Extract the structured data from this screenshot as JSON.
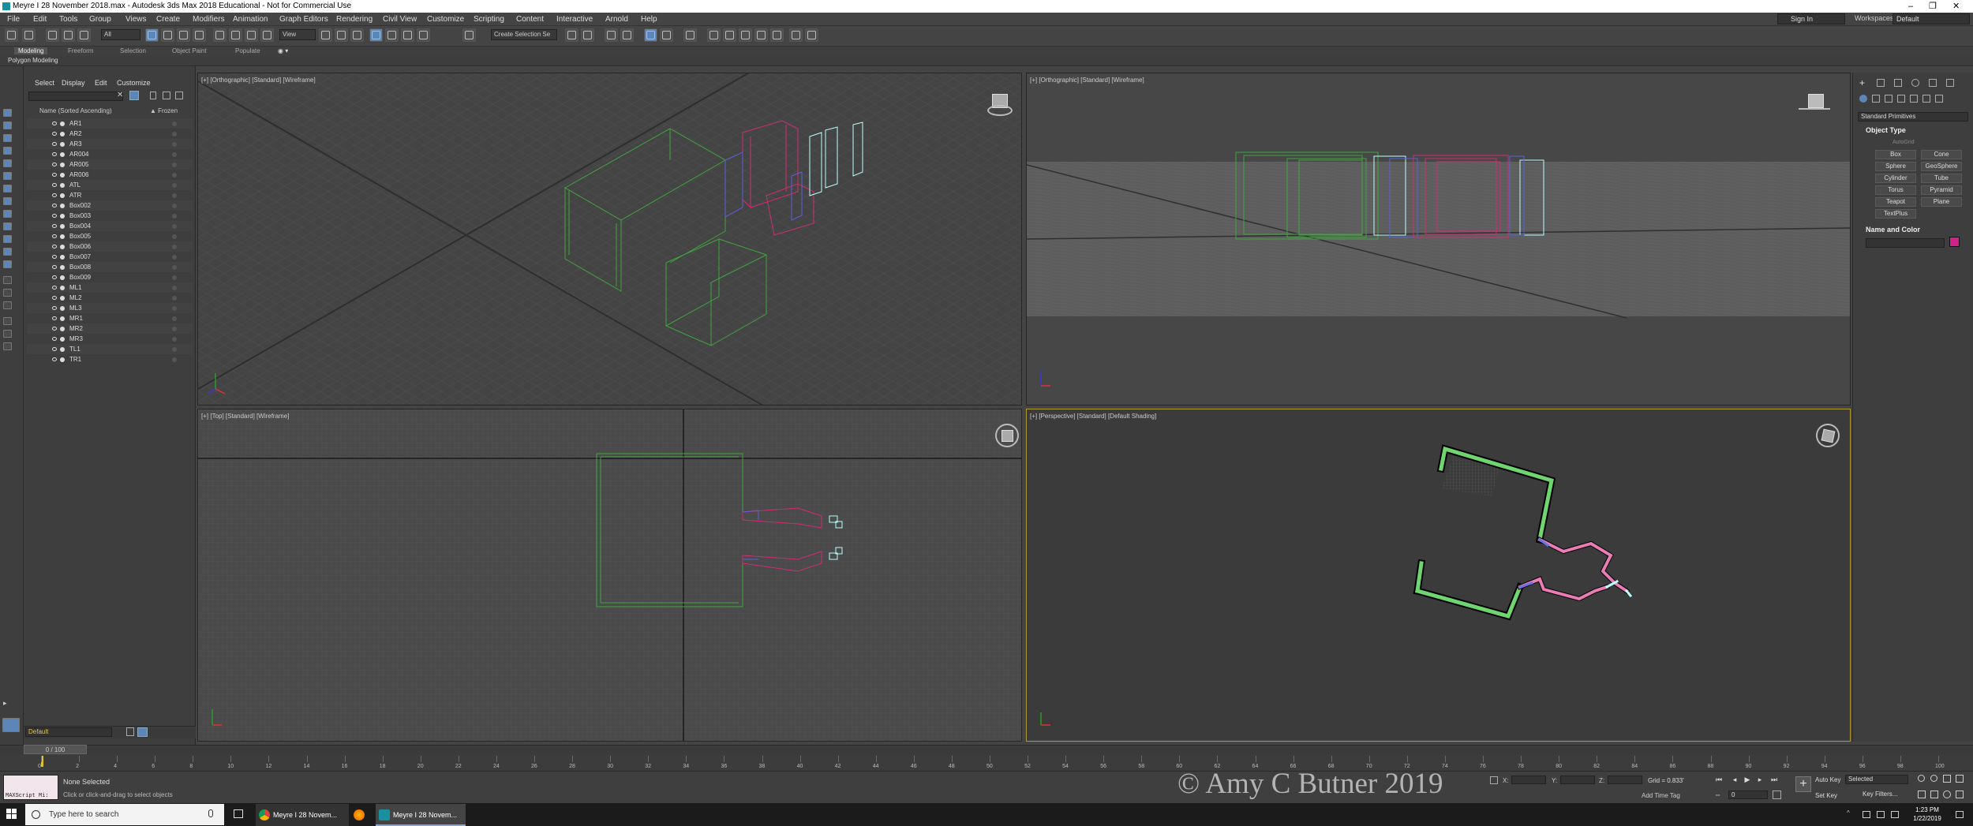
{
  "window": {
    "title": "Meyre I 28 November 2018.max - Autodesk 3ds Max 2018 Educational - Not for Commercial Use",
    "controls": [
      "–",
      "❐",
      "✕"
    ]
  },
  "menus": [
    "File",
    "Edit",
    "Tools",
    "Group",
    "Views",
    "Create",
    "Modifiers",
    "Animation",
    "Graph Editors",
    "Rendering",
    "Civil View",
    "Customize",
    "Scripting",
    "Content",
    "Interactive",
    "Arnold",
    "Help"
  ],
  "account": {
    "signin": "Sign In",
    "workspace_label": "Workspaces:",
    "workspace_value": "Default"
  },
  "toolbar": {
    "filter_value": "All",
    "view_value": "View",
    "selection_set": "Create Selection Se"
  },
  "ribbon": {
    "tabs": [
      "Modeling",
      "Freeform",
      "Selection",
      "Object Paint",
      "Populate"
    ],
    "active": "Modeling",
    "subtitle": "Polygon Modeling"
  },
  "scene_explorer": {
    "tabs": [
      "Select",
      "Display",
      "Edit",
      "Customize"
    ],
    "column_name": "Name (Sorted Ascending)",
    "column_frozen": "▲ Frozen",
    "items": [
      "AR1",
      "AR2",
      "AR3",
      "AR004",
      "AR005",
      "AR006",
      "ATL",
      "ATR",
      "Box002",
      "Box003",
      "Box004",
      "Box005",
      "Box006",
      "Box007",
      "Box008",
      "Box009",
      "ML1",
      "ML2",
      "ML3",
      "MR1",
      "MR2",
      "MR3",
      "TL1",
      "TR1"
    ],
    "layer": "Default"
  },
  "viewports": {
    "top_left": "[+] [Orthographic] [Standard] [Wireframe]",
    "top_right": "[+] [Orthographic] [Standard] [Wireframe]",
    "bottom_left": "[+] [Top] [Standard] [Wireframe]",
    "bottom_right": "[+] [Perspective] [Standard] [Default Shading]"
  },
  "command_panel": {
    "category": "Standard Primitives",
    "object_type_title": "Object Type",
    "autogrid": "AutoGrid",
    "buttons": [
      "Box",
      "Cone",
      "Sphere",
      "GeoSphere",
      "Cylinder",
      "Tube",
      "Torus",
      "Pyramid",
      "Teapot",
      "Plane",
      "TextPlus"
    ],
    "name_color_title": "Name and Color",
    "color": "#d0228a"
  },
  "timeline": {
    "slider": "0 / 100",
    "ticks": [
      "0",
      "2",
      "4",
      "6",
      "8",
      "10",
      "12",
      "14",
      "16",
      "18",
      "20",
      "22",
      "24",
      "26",
      "28",
      "30",
      "32",
      "34",
      "36",
      "38",
      "40",
      "42",
      "44",
      "46",
      "48",
      "50",
      "52",
      "54",
      "56",
      "58",
      "60",
      "62",
      "64",
      "66",
      "68",
      "70",
      "72",
      "74",
      "76",
      "78",
      "80",
      "82",
      "84",
      "86",
      "88",
      "90",
      "92",
      "94",
      "96",
      "98",
      "100"
    ]
  },
  "status": {
    "maxscript": "MAXScript Mi:",
    "selection": "None Selected",
    "hint": "Click or click-and-drag to select objects",
    "watermark": "© Amy C Butner 2019",
    "x_label": "X:",
    "y_label": "Y:",
    "z_label": "Z:",
    "grid": "Grid = 0.833'",
    "add_time_tag": "Add Time Tag",
    "auto_key": "Auto Key",
    "set_key": "Set Key",
    "selected_dropdown": "Selected",
    "key_filters": "Key Filters...",
    "frame": "0"
  },
  "taskbar": {
    "search_placeholder": "Type here to search",
    "apps": [
      "Meyre I 28 Novem...",
      "Meyre I 28 Novem..."
    ],
    "time": "1:23 PM",
    "date": "1/22/2019"
  }
}
